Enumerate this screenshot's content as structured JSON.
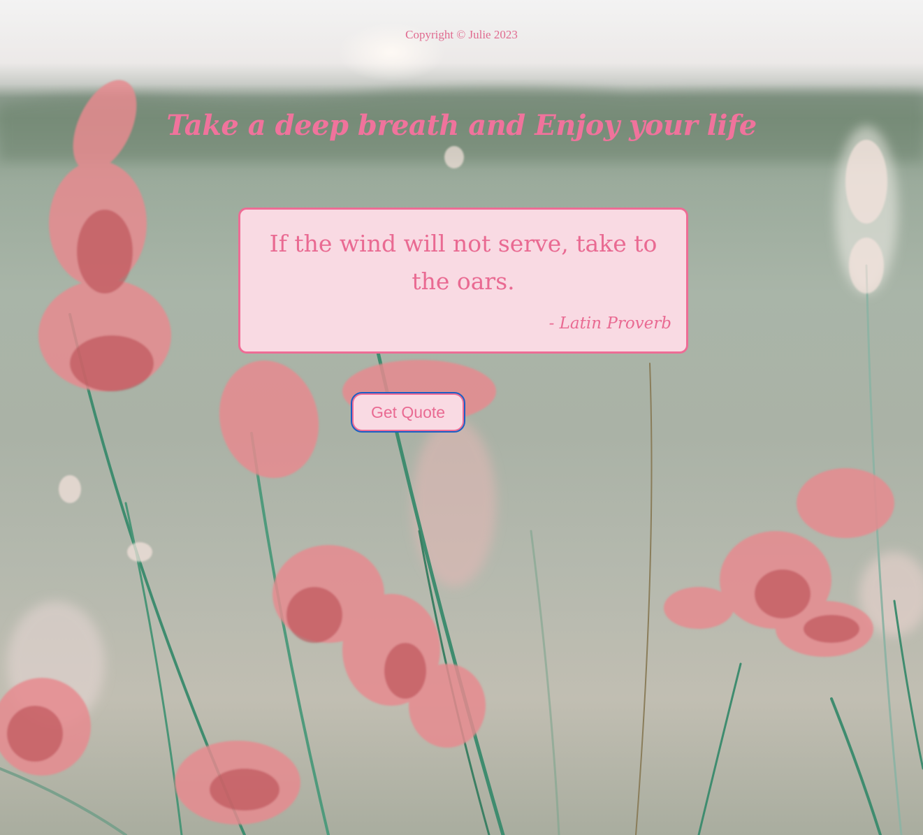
{
  "footer": {
    "copyright": "Copyright © Julie 2023"
  },
  "header": {
    "title": "Take a deep breath and Enjoy your life"
  },
  "quote": {
    "text": "If the wind will not serve, take to the oars.",
    "author": "- Latin Proverb"
  },
  "actions": {
    "get_quote_label": "Get Quote"
  },
  "colors": {
    "accent_pink": "#ee6c95",
    "box_background": "#f9dae3",
    "focus_ring": "#1a5fc4"
  }
}
